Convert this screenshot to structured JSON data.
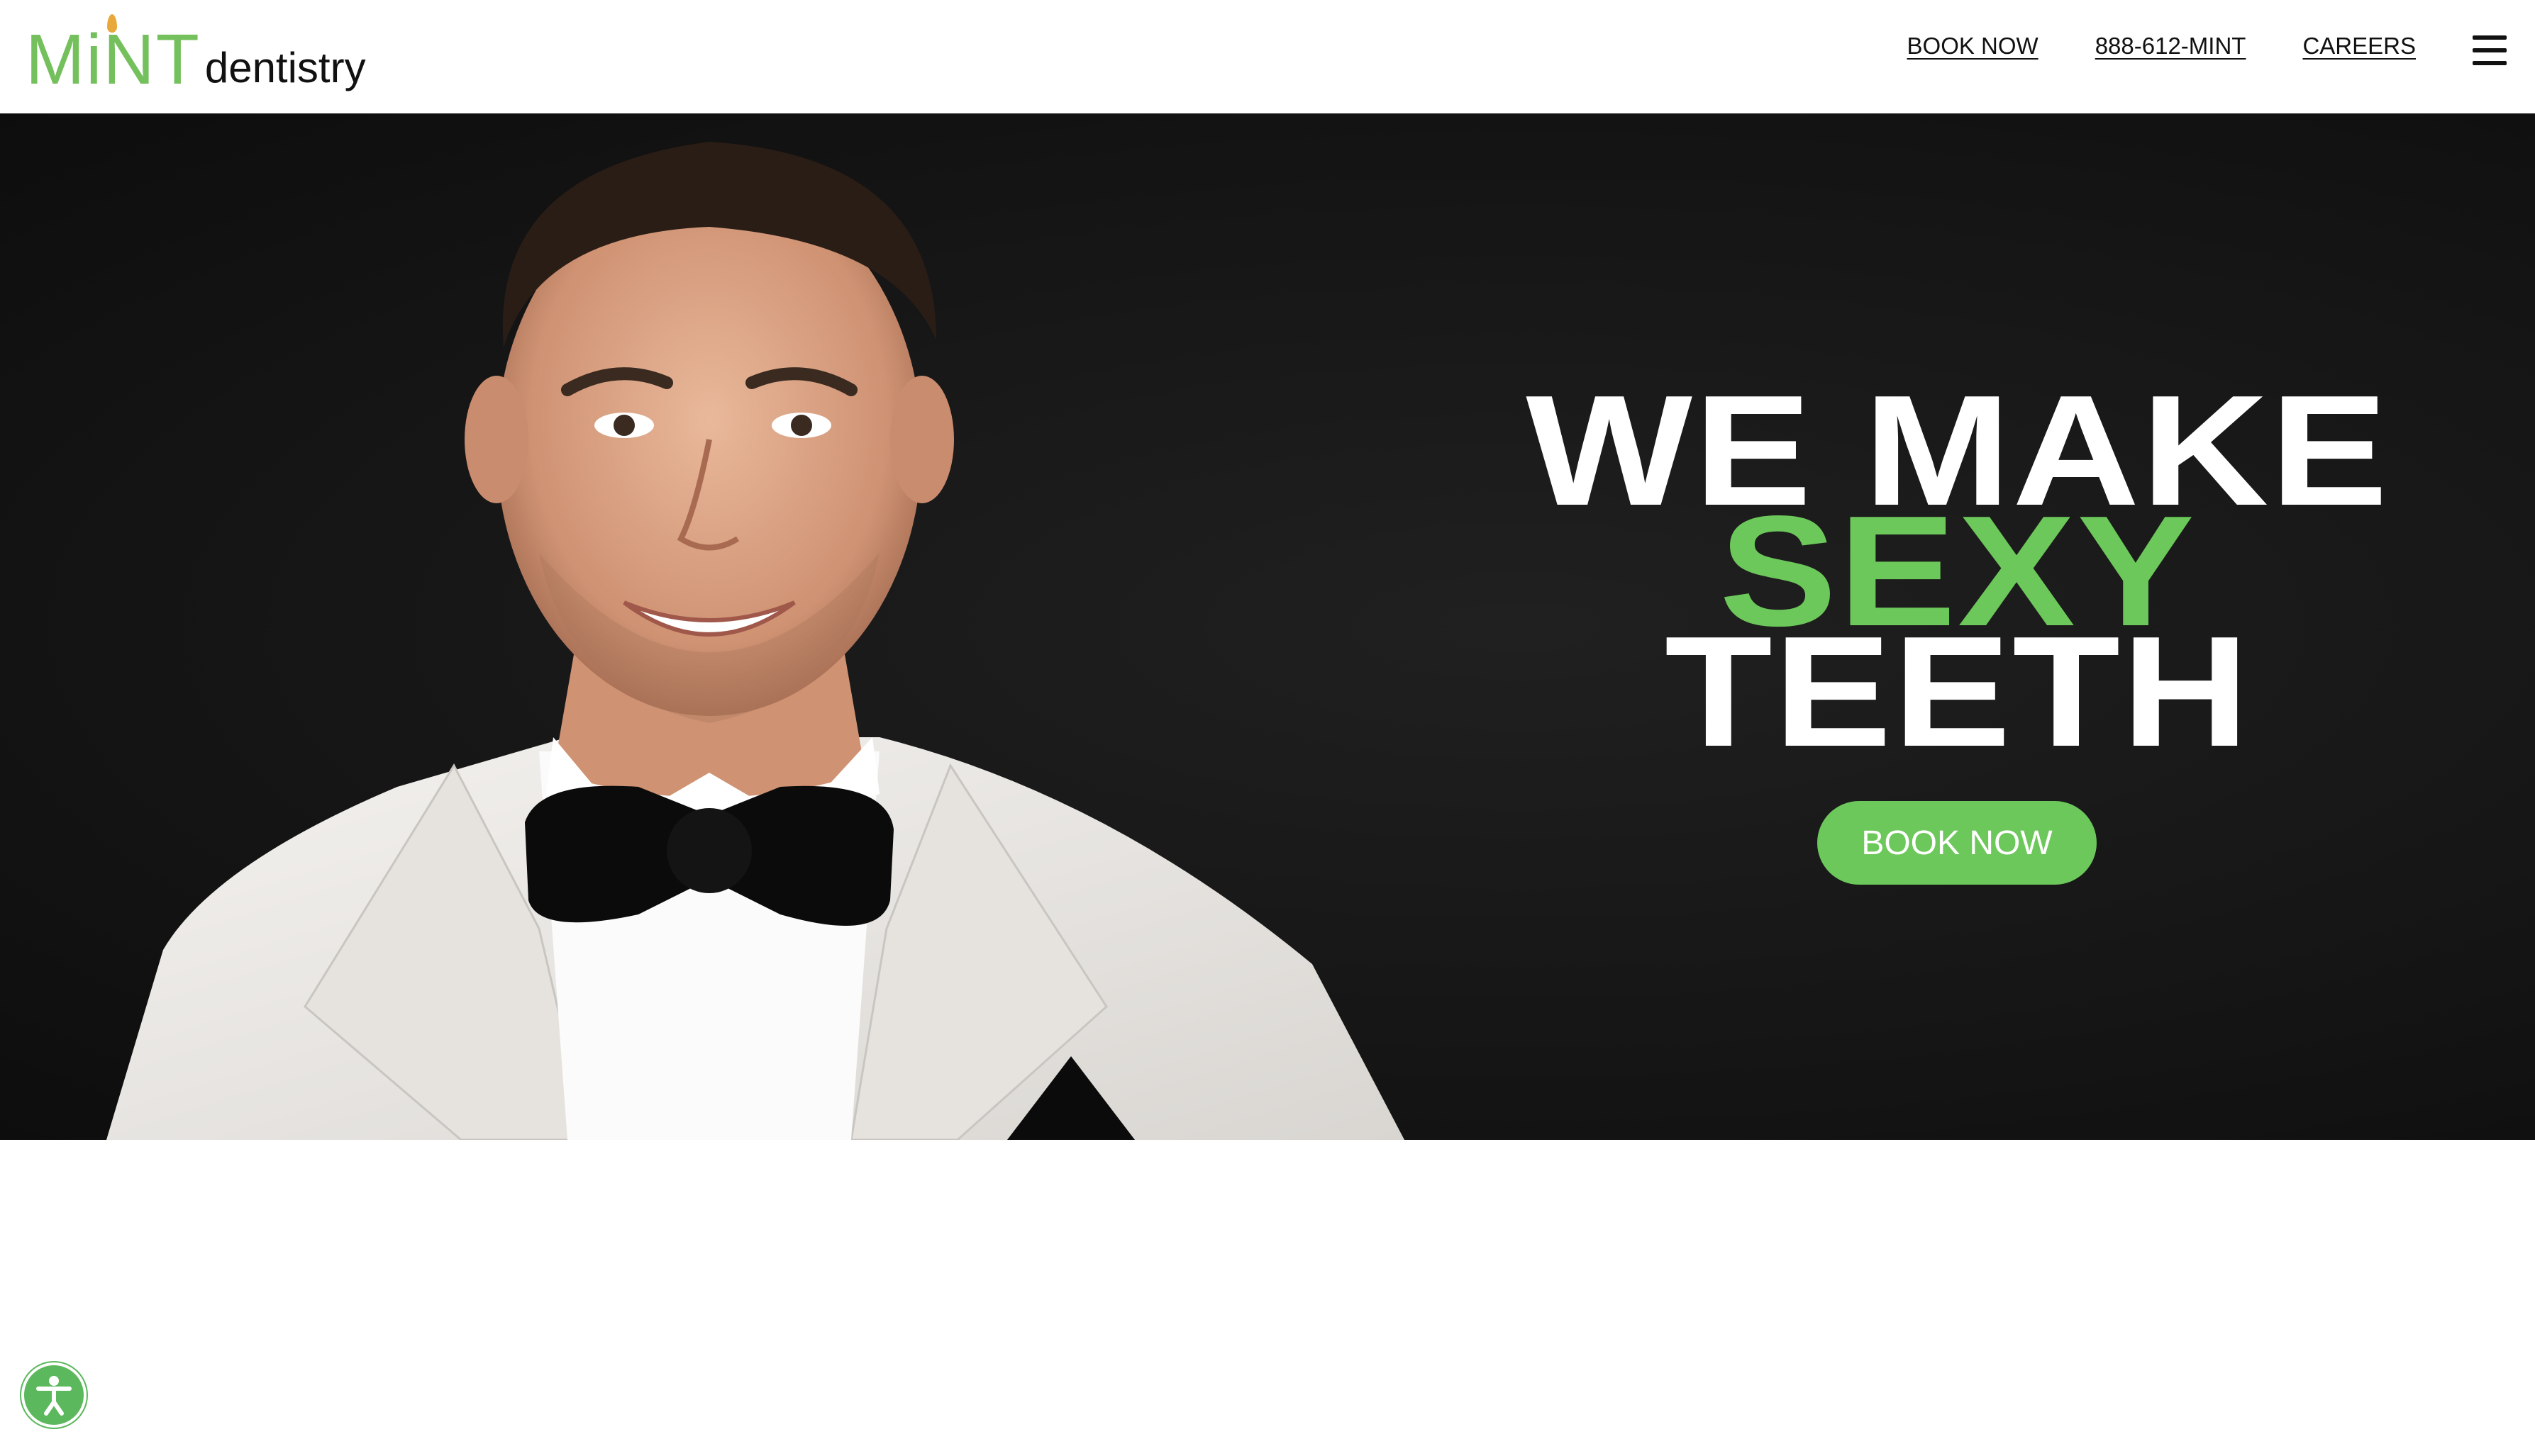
{
  "header": {
    "logo": {
      "brand": "MiNT",
      "sub": "dentistry"
    },
    "nav": [
      {
        "label": "BOOK NOW"
      },
      {
        "label": "888-612-MINT"
      },
      {
        "label": "CAREERS"
      }
    ],
    "menu_icon": "hamburger-menu-icon"
  },
  "hero": {
    "headline_line1": "WE MAKE",
    "headline_line2": "SEXY",
    "headline_line3": "TEETH",
    "cta_label": "BOOK NOW",
    "image": "man-in-white-tuxedo-smiling-photo"
  },
  "accessibility_widget": {
    "icon": "accessibility-person-icon"
  },
  "colors": {
    "brand_green": "#6cc85a",
    "hero_background": "#161616",
    "text_dark": "#111111",
    "logo_leaf": "#e8a93a"
  }
}
